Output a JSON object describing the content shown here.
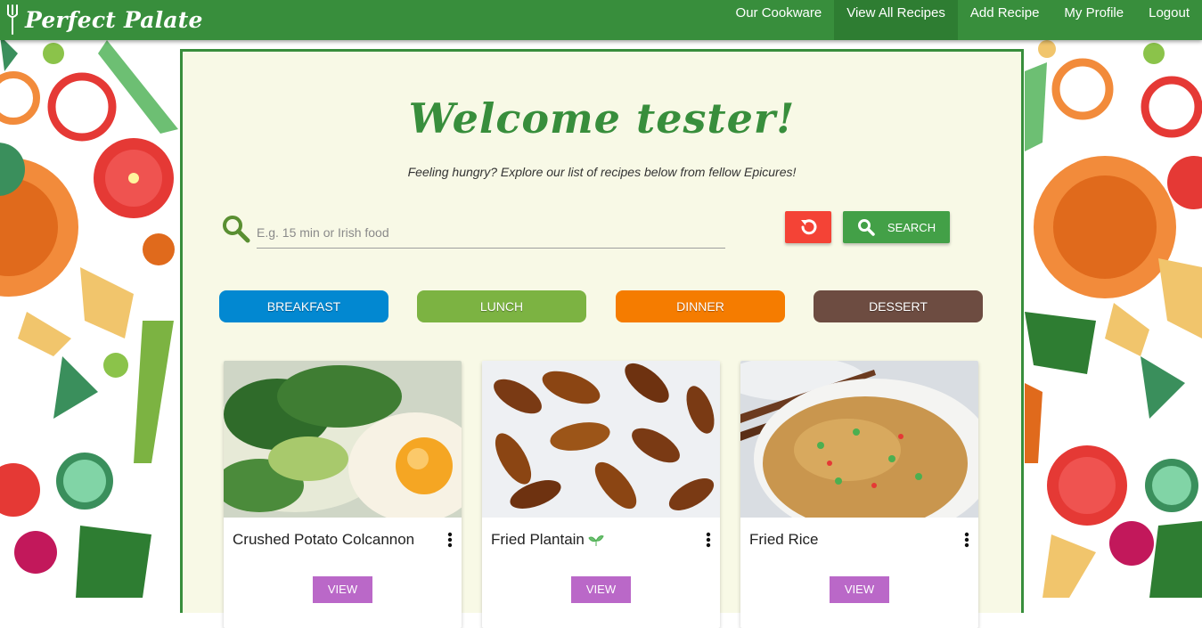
{
  "brand": {
    "name": "Perfect Palate"
  },
  "nav": {
    "links": [
      {
        "label": "Our Cookware"
      },
      {
        "label": "View All Recipes",
        "active": true
      },
      {
        "label": "Add Recipe"
      },
      {
        "label": "My Profile"
      },
      {
        "label": "Logout"
      }
    ]
  },
  "main": {
    "welcome": "Welcome tester!",
    "subtitle": "Feeling hungry? Explore our list of recipes below from fellow Epicures!"
  },
  "search": {
    "placeholder": "E.g. 15 min or Irish food",
    "value": "",
    "button_label": "SEARCH",
    "reset_icon": "undo-icon",
    "search_icon": "magnifier-icon"
  },
  "categories": [
    {
      "label": "BREAKFAST",
      "color": "#0288d1"
    },
    {
      "label": "LUNCH",
      "color": "#7cb342"
    },
    {
      "label": "DINNER",
      "color": "#f57c00"
    },
    {
      "label": "DESSERT",
      "color": "#6d4c41"
    }
  ],
  "recipes": [
    {
      "title": "Crushed Potato Colcannon",
      "vegan_icon": false,
      "view_label": "VIEW"
    },
    {
      "title": "Fried Plantain",
      "vegan_icon": true,
      "view_label": "VIEW"
    },
    {
      "title": "Fried Rice",
      "vegan_icon": false,
      "view_label": "VIEW"
    }
  ],
  "colors": {
    "primary": "#388e3c",
    "panel": "#f8f9e6",
    "reset": "#f44336",
    "search": "#43a047",
    "view": "#ba68c8"
  }
}
